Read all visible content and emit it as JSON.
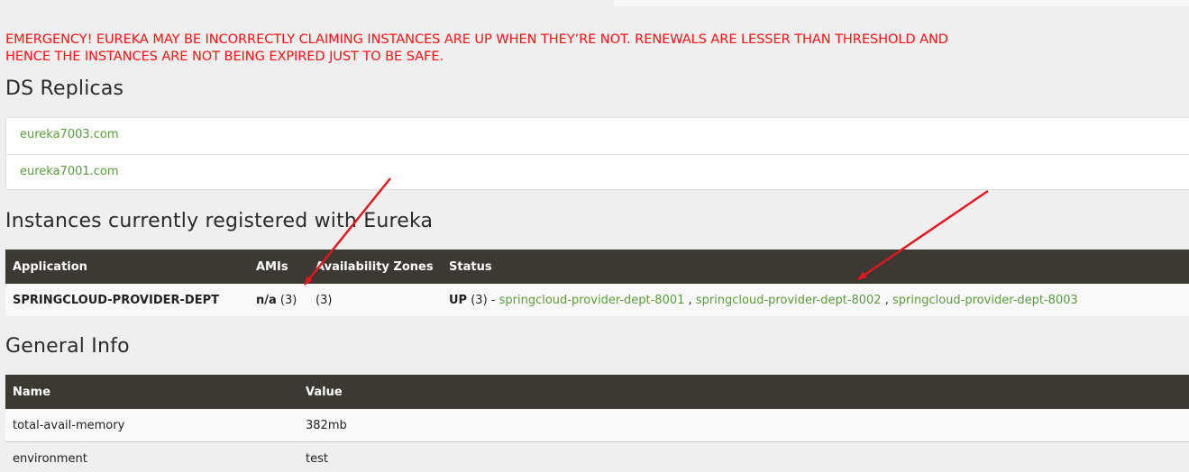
{
  "warning": {
    "line1": "EMERGENCY! EUREKA MAY BE INCORRECTLY CLAIMING INSTANCES ARE UP WHEN THEY’RE NOT. RENEWALS ARE LESSER THAN THRESHOLD AND",
    "line2": "HENCE THE INSTANCES ARE NOT BEING EXPIRED JUST TO BE SAFE.",
    "color": "#ff1111"
  },
  "ds_replicas": {
    "title": "DS Replicas",
    "items": [
      "eureka7003.com",
      "eureka7001.com"
    ]
  },
  "instances": {
    "title": "Instances currently registered with Eureka",
    "headers": [
      "Application",
      "AMIs",
      "Availability Zones",
      "Status"
    ],
    "rows": [
      {
        "application": "SPRINGCLOUD-PROVIDER-DEPT",
        "amis_label": "n/a",
        "amis_count": "(3)",
        "zones": "(3)",
        "status_label": "UP",
        "status_count": "(3) -",
        "instances": [
          "springcloud-provider-dept-8001",
          "springcloud-provider-dept-8002",
          "springcloud-provider-dept-8003"
        ],
        "separator": ","
      }
    ]
  },
  "general_info": {
    "title": "General Info",
    "headers": [
      "Name",
      "Value"
    ],
    "rows": [
      {
        "name": "total-avail-memory",
        "value": "382mb"
      },
      {
        "name": "environment",
        "value": "test"
      }
    ]
  },
  "colors": {
    "link": "#5a9a3d",
    "header_bg": "#3c3834",
    "annotation_arrow": "#e0191e"
  }
}
